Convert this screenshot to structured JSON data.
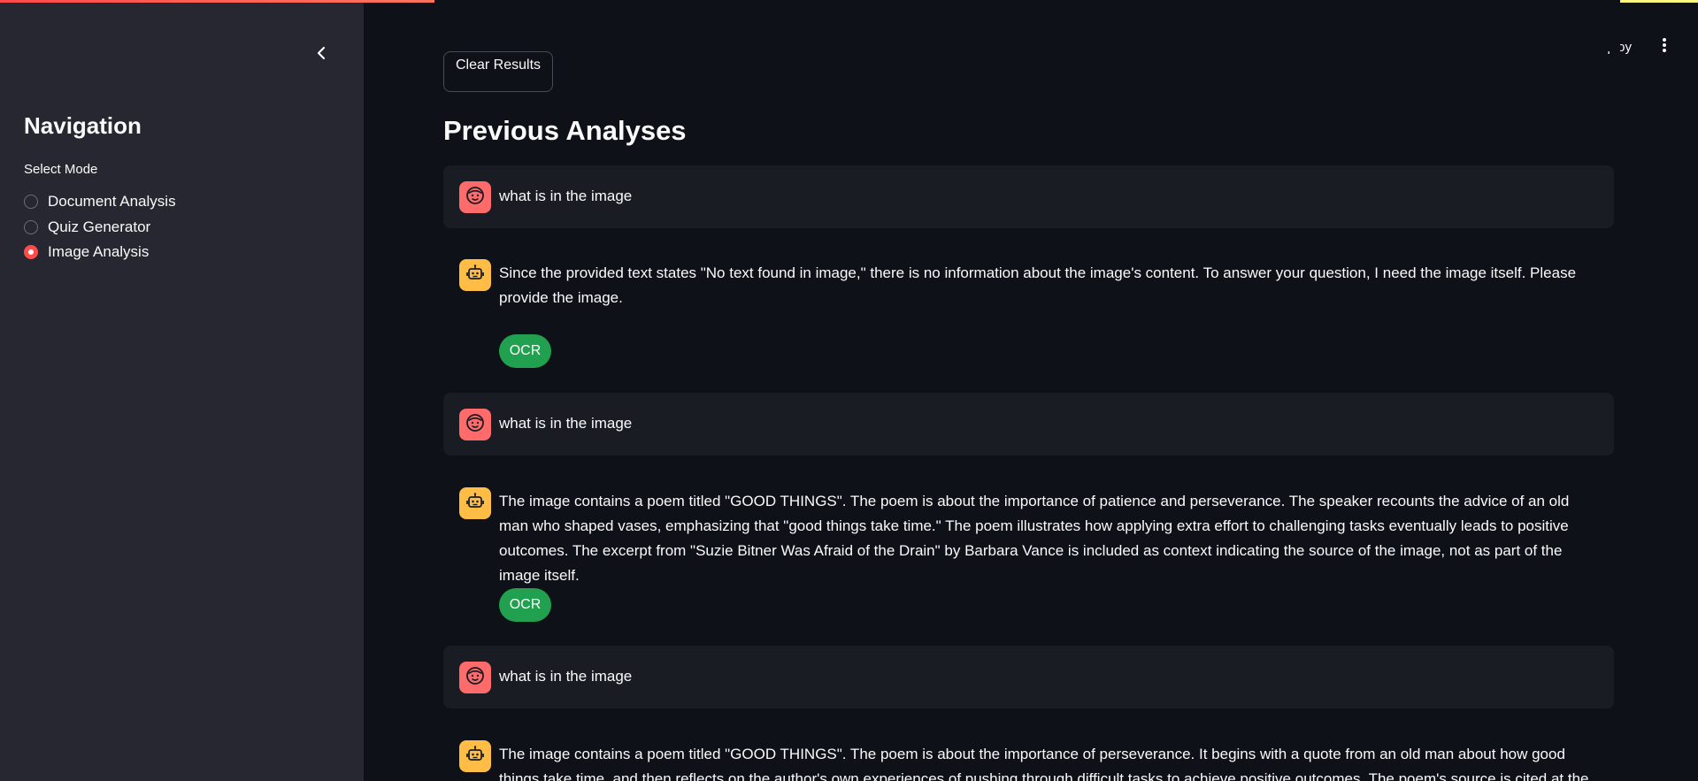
{
  "sidebar": {
    "nav_title": "Navigation",
    "mode_label": "Select Mode",
    "options": [
      {
        "label": "Document Analysis",
        "checked": false
      },
      {
        "label": "Quiz Generator",
        "checked": false
      },
      {
        "label": "Image Analysis",
        "checked": true
      }
    ]
  },
  "header": {
    "deploy_label": "Deploy"
  },
  "main": {
    "clear_button": "Clear Results",
    "section_title": "Previous Analyses",
    "messages": [
      {
        "role": "user",
        "text": "what is in the image"
      },
      {
        "role": "assistant",
        "text": "Since the provided text states \"No text found in image,\" there is no information about the image's content. To answer your question, I need the image itself. Please provide the image.",
        "badge": "OCR"
      },
      {
        "role": "user",
        "text": "what is in the image"
      },
      {
        "role": "assistant",
        "text": "The image contains a poem titled \"GOOD THINGS\". The poem is about the importance of patience and perseverance. The speaker recounts the advice of an old man who shaped vases, emphasizing that \"good things take time.\" The poem illustrates how applying extra effort to challenging tasks eventually leads to positive outcomes. The excerpt from \"Suzie Bitner Was Afraid of the Drain\" by Barbara Vance is included as context indicating the source of the image, not as part of the image itself.",
        "badge": "OCR"
      },
      {
        "role": "user",
        "text": "what is in the image"
      },
      {
        "role": "assistant",
        "text": "The image contains a poem titled \"GOOD THINGS\". The poem is about the importance of perseverance. It begins with a quote from an old man about how good things take time, and then reflects on the author's own experiences of pushing through difficult tasks to achieve positive outcomes. The poem's source is cited at the bottom."
      }
    ]
  },
  "colors": {
    "accent": "#ff4b4b",
    "user_avatar": "#ff6b6b",
    "bot_avatar": "#ffbd45",
    "ocr_badge": "#21a050"
  }
}
